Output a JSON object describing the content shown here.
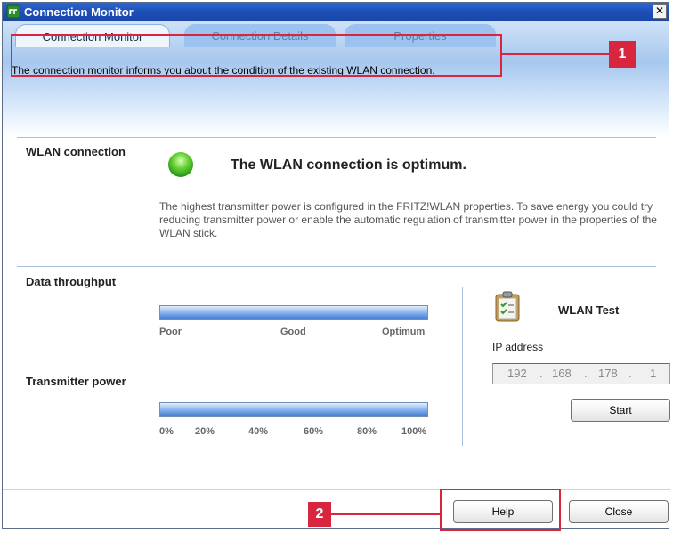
{
  "window": {
    "title": "Connection Monitor",
    "close_glyph": "✕"
  },
  "tabs": [
    {
      "label": "Connection Monitor",
      "active": true
    },
    {
      "label": "Connection Details",
      "active": false
    },
    {
      "label": "Properties",
      "active": false
    }
  ],
  "description": "The connection monitor informs you about the condition of the existing WLAN connection.",
  "wlan": {
    "label": "WLAN connection",
    "status_text": "The WLAN connection is optimum.",
    "hint": "The highest transmitter power is configured in the FRITZ!WLAN properties. To save energy you could try reducing transmitter power or enable the automatic regulation of transmitter power in the properties of the WLAN stick.",
    "status_color": "#3cb81c"
  },
  "throughput": {
    "label": "Data throughput",
    "level": 1.0,
    "scale": [
      "Poor",
      "Good",
      "Optimum"
    ]
  },
  "power": {
    "label": "Transmitter power",
    "level": 1.0,
    "scale": [
      "0%",
      "20%",
      "40%",
      "60%",
      "80%",
      "100%"
    ]
  },
  "test": {
    "title": "WLAN Test",
    "ip_label": "IP address",
    "ip": [
      "192",
      "168",
      "178",
      "1"
    ],
    "start_label": "Start"
  },
  "buttons": {
    "help": "Help",
    "close": "Close"
  },
  "annotations": {
    "badge1": "1",
    "badge2": "2",
    "color": "#d7263d"
  }
}
